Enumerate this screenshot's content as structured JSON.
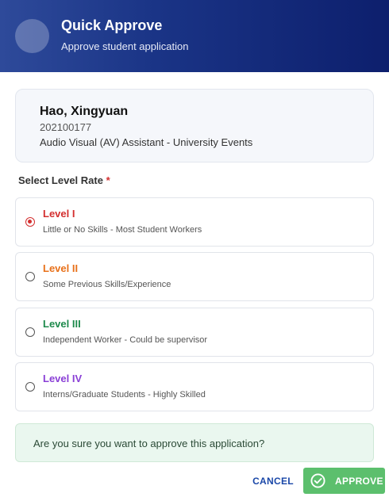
{
  "header": {
    "title": "Quick Approve",
    "subtitle": "Approve student application"
  },
  "student": {
    "name": "Hao, Xingyuan",
    "id": "202100177",
    "position": "Audio Visual (AV) Assistant - University Events"
  },
  "level_select": {
    "label": "Select Level Rate",
    "required_mark": "*",
    "selected": "Level I",
    "options": [
      {
        "title": "Level I",
        "description": "Little or No Skills - Most Student Workers",
        "color": "#d32f2f",
        "checked": true
      },
      {
        "title": "Level II",
        "description": "Some Previous Skills/Experience",
        "color": "#e8711a",
        "checked": false
      },
      {
        "title": "Level III",
        "description": "Independent Worker - Could be supervisor",
        "color": "#1e8a4c",
        "checked": false
      },
      {
        "title": "Level IV",
        "description": "Interns/Graduate Students - Highly Skilled",
        "color": "#8a3fd6",
        "checked": false
      }
    ]
  },
  "confirm": {
    "message": "Are you sure you want to approve this application?"
  },
  "actions": {
    "cancel_label": "CANCEL",
    "approve_label": "APPROVE",
    "approve_icon": "check-circle-icon"
  },
  "colors": {
    "header_start": "#2e4a9a",
    "header_end": "#0d1f6d",
    "approve": "#5cbf6d",
    "cancel": "#1a47a8"
  }
}
